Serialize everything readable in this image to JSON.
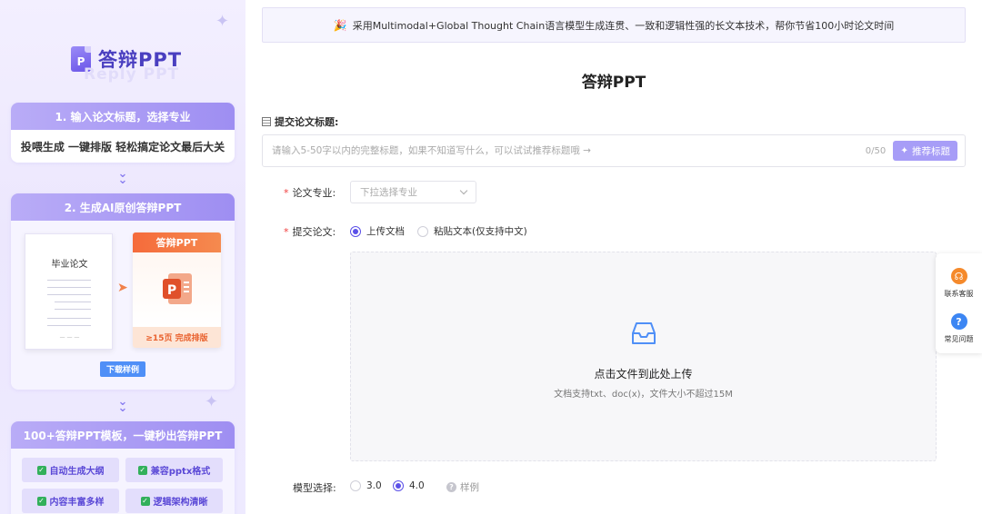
{
  "sidebar": {
    "logo_text": "答辩PPT",
    "logo_subtext": "Reply PPT",
    "logo_icon_letter": "P",
    "step1": {
      "title": "1. 输入论文标题，选择专业",
      "body": "投喂生成 一键排版 轻松搞定论文最后大关"
    },
    "step2": {
      "title": "2. 生成AI原创答辩PPT",
      "paper_title": "毕业论文",
      "ppt_title": "答辩PPT",
      "ppt_footer": "≥15页 完成排版",
      "download_label": "下载样例"
    },
    "step3": {
      "title": "100+答辩PPT模板，一键秒出答辩PPT",
      "features": [
        "自动生成大纲",
        "兼容pptx格式",
        "内容丰富多样",
        "逻辑架构清晰"
      ]
    }
  },
  "banner": {
    "text": "采用Multimodal+Global Thought Chain语言模型生成连贯、一致和逻辑性强的长文本技术，帮你节省100小时论文时间"
  },
  "page_title": "答辩PPT",
  "form": {
    "title_label": "提交论文标题:",
    "title_placeholder": "请输入5-50字以内的完整标题，如果不知道写什么，可以试试推荐标题哦 →",
    "title_counter": "0/50",
    "recommend_label": "推荐标题",
    "major_label": "论文专业:",
    "major_placeholder": "下拉选择专业",
    "submit_label": "提交论文:",
    "submit_options": [
      {
        "label": "上传文档",
        "selected": true
      },
      {
        "label": "粘贴文本(仅支持中文)",
        "selected": false
      }
    ],
    "upload_main": "点击文件到此处上传",
    "upload_sub": "文档支持txt、doc(x)，文件大小不超过15M",
    "model_label": "模型选择:",
    "model_options": [
      {
        "label": "3.0",
        "selected": false
      },
      {
        "label": "4.0",
        "selected": true
      }
    ],
    "sample_label": "样例"
  },
  "float_panel": {
    "contact_label": "联系客服",
    "faq_label": "常见问题"
  },
  "colors": {
    "accent": "#5b50e8",
    "sidebar_head": "#a596f4",
    "ppt_orange": "#f56b3b",
    "download_blue": "#4f8ff7",
    "check_green": "#32b05b"
  }
}
